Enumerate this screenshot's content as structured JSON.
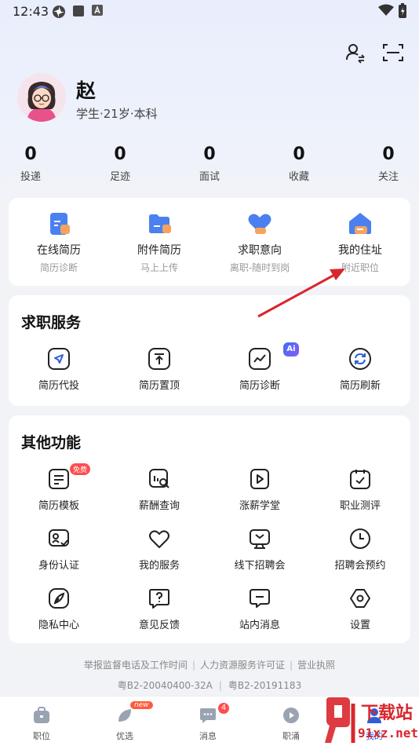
{
  "status_bar": {
    "time": "12:43"
  },
  "profile": {
    "name": "赵",
    "info": "学生·21岁·本科"
  },
  "stats": [
    {
      "value": "0",
      "label": "投递"
    },
    {
      "value": "0",
      "label": "足迹"
    },
    {
      "value": "0",
      "label": "面试"
    },
    {
      "value": "0",
      "label": "收藏"
    },
    {
      "value": "0",
      "label": "关注"
    }
  ],
  "quick": [
    {
      "title": "在线简历",
      "sub": "简历诊断",
      "icon": "resume-online-icon"
    },
    {
      "title": "附件简历",
      "sub": "马上上传",
      "icon": "folder-icon"
    },
    {
      "title": "求职意向",
      "sub": "离职-随时到岗",
      "icon": "heart-icon"
    },
    {
      "title": "我的住址",
      "sub": "附近职位",
      "icon": "home-icon"
    }
  ],
  "services": {
    "title": "求职服务",
    "ai_badge": "Ai",
    "items": [
      {
        "label": "简历代投",
        "icon": "send-icon"
      },
      {
        "label": "简历置顶",
        "icon": "pin-top-icon"
      },
      {
        "label": "简历诊断",
        "icon": "diagnose-icon"
      },
      {
        "label": "简历刷新",
        "icon": "refresh-icon"
      }
    ]
  },
  "other": {
    "title": "其他功能",
    "free_badge": "免费",
    "items": [
      {
        "label": "简历模板",
        "icon": "template-icon"
      },
      {
        "label": "薪酬查询",
        "icon": "salary-search-icon"
      },
      {
        "label": "涨薪学堂",
        "icon": "video-play-icon"
      },
      {
        "label": "职业测评",
        "icon": "calendar-check-icon"
      },
      {
        "label": "身份认证",
        "icon": "id-card-icon"
      },
      {
        "label": "我的服务",
        "icon": "heart-outline-icon"
      },
      {
        "label": "线下招聘会",
        "icon": "meeting-icon"
      },
      {
        "label": "招聘会预约",
        "icon": "clock-icon"
      },
      {
        "label": "隐私中心",
        "icon": "feather-icon"
      },
      {
        "label": "意见反馈",
        "icon": "feedback-icon"
      },
      {
        "label": "站内消息",
        "icon": "message-icon"
      },
      {
        "label": "设置",
        "icon": "settings-icon"
      }
    ]
  },
  "footer": {
    "links": [
      "举报监督电话及工作时间",
      "人力资源服务许可证",
      "营业执照"
    ],
    "license1": "粤B2-20040400-32A",
    "license2": "粤B2-20191183"
  },
  "tabs": [
    {
      "label": "职位",
      "icon": "briefcase-icon"
    },
    {
      "label": "优选",
      "icon": "leaf-icon",
      "badge": "new"
    },
    {
      "label": "消息",
      "icon": "chat-icon",
      "badge": "4"
    },
    {
      "label": "职涌",
      "icon": "play-circle-icon"
    },
    {
      "label": "我的",
      "icon": "person-icon"
    }
  ],
  "watermark": {
    "text1": "下载站",
    "text2": "91xz.net"
  },
  "colors": {
    "accent": "#3b6ff5",
    "red": "#ff4d4f",
    "arrow": "#d9262c"
  }
}
